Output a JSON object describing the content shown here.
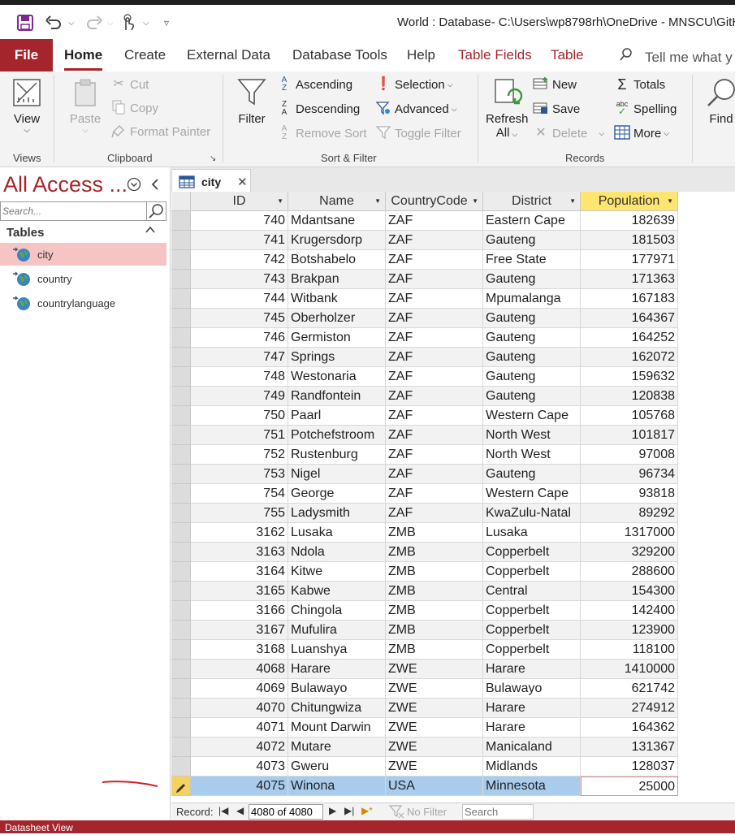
{
  "window": {
    "title": "World : Database- C:\\Users\\wp8798rh\\OneDrive - MNSCU\\GitH"
  },
  "ribbon_tabs": {
    "file": "File",
    "tabs": [
      "Home",
      "Create",
      "External Data",
      "Database Tools",
      "Help",
      "Table Fields",
      "Table"
    ],
    "tell_me": "Tell me what y"
  },
  "ribbon": {
    "views": {
      "view": "View",
      "label": "Views"
    },
    "clipboard": {
      "paste": "Paste",
      "cut": "Cut",
      "copy": "Copy",
      "format_painter": "Format Painter",
      "label": "Clipboard"
    },
    "sort_filter": {
      "filter": "Filter",
      "ascending": "Ascending",
      "descending": "Descending",
      "remove_sort": "Remove Sort",
      "selection": "Selection",
      "advanced": "Advanced",
      "toggle_filter": "Toggle Filter",
      "label": "Sort & Filter"
    },
    "records": {
      "refresh": "Refresh",
      "refresh_all": "All",
      "new": "New",
      "save": "Save",
      "delete": "Delete",
      "totals": "Totals",
      "spelling": "Spelling",
      "more": "More",
      "label": "Records"
    },
    "find": {
      "find": "Find"
    }
  },
  "nav_pane": {
    "title": "All Access ...",
    "search_placeholder": "Search...",
    "section": "Tables",
    "items": [
      "city",
      "country",
      "countrylanguage"
    ],
    "selected": "city"
  },
  "document_tab": {
    "label": "city"
  },
  "datasheet": {
    "columns": [
      "ID",
      "Name",
      "CountryCode",
      "District",
      "Population"
    ],
    "sorted_column": "Population",
    "rows": [
      [
        "740",
        "Mdantsane",
        "ZAF",
        "Eastern Cape",
        "182639"
      ],
      [
        "741",
        "Krugersdorp",
        "ZAF",
        "Gauteng",
        "181503"
      ],
      [
        "742",
        "Botshabelo",
        "ZAF",
        "Free State",
        "177971"
      ],
      [
        "743",
        "Brakpan",
        "ZAF",
        "Gauteng",
        "171363"
      ],
      [
        "744",
        "Witbank",
        "ZAF",
        "Mpumalanga",
        "167183"
      ],
      [
        "745",
        "Oberholzer",
        "ZAF",
        "Gauteng",
        "164367"
      ],
      [
        "746",
        "Germiston",
        "ZAF",
        "Gauteng",
        "164252"
      ],
      [
        "747",
        "Springs",
        "ZAF",
        "Gauteng",
        "162072"
      ],
      [
        "748",
        "Westonaria",
        "ZAF",
        "Gauteng",
        "159632"
      ],
      [
        "749",
        "Randfontein",
        "ZAF",
        "Gauteng",
        "120838"
      ],
      [
        "750",
        "Paarl",
        "ZAF",
        "Western Cape",
        "105768"
      ],
      [
        "751",
        "Potchefstroom",
        "ZAF",
        "North West",
        "101817"
      ],
      [
        "752",
        "Rustenburg",
        "ZAF",
        "North West",
        "97008"
      ],
      [
        "753",
        "Nigel",
        "ZAF",
        "Gauteng",
        "96734"
      ],
      [
        "754",
        "George",
        "ZAF",
        "Western Cape",
        "93818"
      ],
      [
        "755",
        "Ladysmith",
        "ZAF",
        "KwaZulu-Natal",
        "89292"
      ],
      [
        "3162",
        "Lusaka",
        "ZMB",
        "Lusaka",
        "1317000"
      ],
      [
        "3163",
        "Ndola",
        "ZMB",
        "Copperbelt",
        "329200"
      ],
      [
        "3164",
        "Kitwe",
        "ZMB",
        "Copperbelt",
        "288600"
      ],
      [
        "3165",
        "Kabwe",
        "ZMB",
        "Central",
        "154300"
      ],
      [
        "3166",
        "Chingola",
        "ZMB",
        "Copperbelt",
        "142400"
      ],
      [
        "3167",
        "Mufulira",
        "ZMB",
        "Copperbelt",
        "123900"
      ],
      [
        "3168",
        "Luanshya",
        "ZMB",
        "Copperbelt",
        "118100"
      ],
      [
        "4068",
        "Harare",
        "ZWE",
        "Harare",
        "1410000"
      ],
      [
        "4069",
        "Bulawayo",
        "ZWE",
        "Bulawayo",
        "621742"
      ],
      [
        "4070",
        "Chitungwiza",
        "ZWE",
        "Harare",
        "274912"
      ],
      [
        "4071",
        "Mount Darwin",
        "ZWE",
        "Harare",
        "164362"
      ],
      [
        "4072",
        "Mutare",
        "ZWE",
        "Manicaland",
        "131367"
      ],
      [
        "4073",
        "Gweru",
        "ZWE",
        "Midlands",
        "128037"
      ],
      [
        "4075",
        "Winona",
        "USA",
        "Minnesota",
        "25000"
      ]
    ],
    "current_row": 29
  },
  "record_nav": {
    "label": "Record:",
    "position": "4080 of 4080",
    "no_filter": "No Filter",
    "search": "Search"
  },
  "status_bar": {
    "text": "Datasheet View"
  },
  "colors": {
    "accent": "#a4262c",
    "selected_row": "#a8cdec",
    "sorted_header": "#fde56f",
    "nav_selected": "#f7c4c4"
  }
}
